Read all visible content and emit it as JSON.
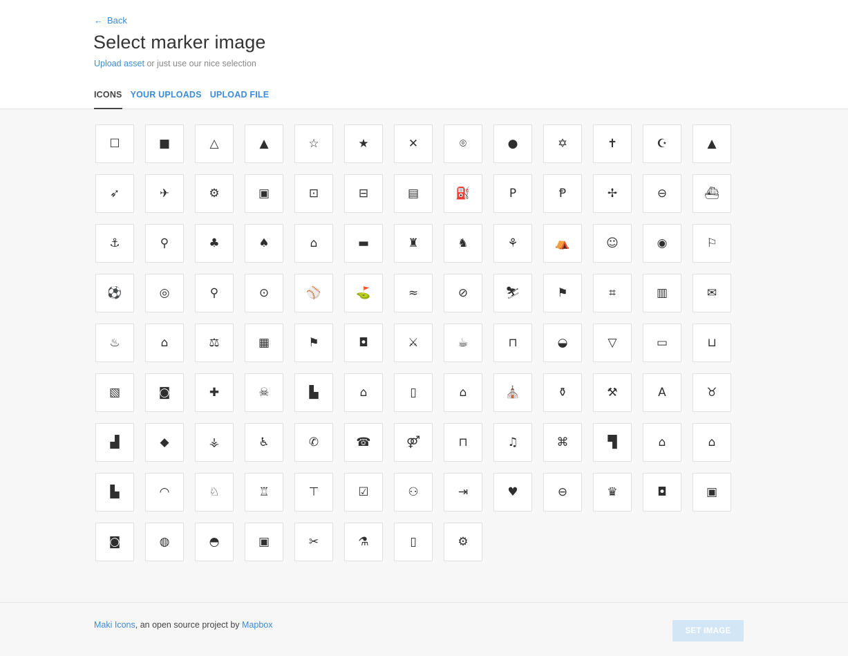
{
  "header": {
    "back_label": "Back",
    "title": "Select marker image",
    "upload_link": "Upload asset",
    "subtitle_rest": " or just use our nice selection"
  },
  "tabs": [
    {
      "label": "ICONS",
      "active": true
    },
    {
      "label": "YOUR UPLOADS",
      "active": false
    },
    {
      "label": "UPLOAD FILE",
      "active": false
    }
  ],
  "icons": [
    {
      "name": "square-stroked",
      "glyph": "☐"
    },
    {
      "name": "square",
      "glyph": "■"
    },
    {
      "name": "triangle-stroked",
      "glyph": "△"
    },
    {
      "name": "triangle",
      "glyph": "▲"
    },
    {
      "name": "star-stroked",
      "glyph": "☆"
    },
    {
      "name": "star",
      "glyph": "★"
    },
    {
      "name": "cross",
      "glyph": "✕"
    },
    {
      "name": "marker-stroked",
      "glyph": "⌾"
    },
    {
      "name": "marker",
      "glyph": "●"
    },
    {
      "name": "religious-jewish",
      "glyph": "✡"
    },
    {
      "name": "religious-christian",
      "glyph": "✝"
    },
    {
      "name": "religious-muslim",
      "glyph": "☪"
    },
    {
      "name": "cemetery",
      "glyph": "▲"
    },
    {
      "name": "rocket",
      "glyph": "➶"
    },
    {
      "name": "airport",
      "glyph": "✈"
    },
    {
      "name": "heliport",
      "glyph": "⚙"
    },
    {
      "name": "rail",
      "glyph": "▣"
    },
    {
      "name": "rail-metro",
      "glyph": "⊡"
    },
    {
      "name": "rail-light",
      "glyph": "⊟"
    },
    {
      "name": "bus",
      "glyph": "▤"
    },
    {
      "name": "fuel",
      "glyph": "⛽"
    },
    {
      "name": "parking",
      "glyph": "P"
    },
    {
      "name": "parking-garage",
      "glyph": "Ᵽ"
    },
    {
      "name": "airfield",
      "glyph": "✢"
    },
    {
      "name": "roadblock",
      "glyph": "⊖"
    },
    {
      "name": "ferry",
      "glyph": "⛴"
    },
    {
      "name": "harbor",
      "glyph": "⚓"
    },
    {
      "name": "bicycle",
      "glyph": "⚲"
    },
    {
      "name": "park",
      "glyph": "♣"
    },
    {
      "name": "park2",
      "glyph": "♠"
    },
    {
      "name": "museum",
      "glyph": "⌂"
    },
    {
      "name": "lodging",
      "glyph": "▬"
    },
    {
      "name": "monument",
      "glyph": "♜"
    },
    {
      "name": "zoo",
      "glyph": "♞"
    },
    {
      "name": "garden",
      "glyph": "⚘"
    },
    {
      "name": "campsite",
      "glyph": "⛺"
    },
    {
      "name": "theatre",
      "glyph": "☺"
    },
    {
      "name": "art-gallery",
      "glyph": "◉"
    },
    {
      "name": "pitch",
      "glyph": "⚐"
    },
    {
      "name": "soccer",
      "glyph": "⚽"
    },
    {
      "name": "america-football",
      "glyph": "◎"
    },
    {
      "name": "tennis",
      "glyph": "⚲"
    },
    {
      "name": "basketball",
      "glyph": "⊙"
    },
    {
      "name": "baseball",
      "glyph": "⚾"
    },
    {
      "name": "golf",
      "glyph": "⛳"
    },
    {
      "name": "swimming",
      "glyph": "≈"
    },
    {
      "name": "cricket",
      "glyph": "⊘"
    },
    {
      "name": "skiing",
      "glyph": "⛷"
    },
    {
      "name": "school",
      "glyph": "⚑"
    },
    {
      "name": "college",
      "glyph": "⌗"
    },
    {
      "name": "library",
      "glyph": "▥"
    },
    {
      "name": "post",
      "glyph": "✉"
    },
    {
      "name": "fire-station",
      "glyph": "♨"
    },
    {
      "name": "town-hall",
      "glyph": "⌂"
    },
    {
      "name": "police",
      "glyph": "⚖"
    },
    {
      "name": "prison",
      "glyph": "▦"
    },
    {
      "name": "embassy",
      "glyph": "⚑"
    },
    {
      "name": "beer",
      "glyph": "◘"
    },
    {
      "name": "restaurant",
      "glyph": "⚔"
    },
    {
      "name": "cafe",
      "glyph": "☕"
    },
    {
      "name": "shop",
      "glyph": "⊓"
    },
    {
      "name": "fast-food",
      "glyph": "◒"
    },
    {
      "name": "bar",
      "glyph": "▽"
    },
    {
      "name": "bank",
      "glyph": "▭"
    },
    {
      "name": "grocery",
      "glyph": "⊔"
    },
    {
      "name": "cinema",
      "glyph": "▧"
    },
    {
      "name": "pharmacy",
      "glyph": "◙"
    },
    {
      "name": "hospital",
      "glyph": "✚"
    },
    {
      "name": "danger",
      "glyph": "☠"
    },
    {
      "name": "industrial",
      "glyph": "▙"
    },
    {
      "name": "warehouse",
      "glyph": "⌂"
    },
    {
      "name": "commercial",
      "glyph": "▯"
    },
    {
      "name": "building",
      "glyph": "⌂"
    },
    {
      "name": "place-of-worship",
      "glyph": "⛪"
    },
    {
      "name": "alcohol-shop",
      "glyph": "⚱"
    },
    {
      "name": "logging",
      "glyph": "⚒"
    },
    {
      "name": "oil-well",
      "glyph": "A"
    },
    {
      "name": "slaughterhouse",
      "glyph": "♉"
    },
    {
      "name": "dam",
      "glyph": "▟"
    },
    {
      "name": "water",
      "glyph": "◆"
    },
    {
      "name": "wetland",
      "glyph": "⚶"
    },
    {
      "name": "disability",
      "glyph": "♿"
    },
    {
      "name": "telephone",
      "glyph": "✆"
    },
    {
      "name": "emergency-telephone",
      "glyph": "☎"
    },
    {
      "name": "toilets",
      "glyph": "⚤"
    },
    {
      "name": "waste-basket",
      "glyph": "⊓"
    },
    {
      "name": "music",
      "glyph": "♫"
    },
    {
      "name": "land-use",
      "glyph": "⌘"
    },
    {
      "name": "city",
      "glyph": "▜"
    },
    {
      "name": "town",
      "glyph": "⌂"
    },
    {
      "name": "village",
      "glyph": "⌂"
    },
    {
      "name": "farm",
      "glyph": "▙"
    },
    {
      "name": "bakery",
      "glyph": "◠"
    },
    {
      "name": "dog-park",
      "glyph": "♘"
    },
    {
      "name": "lighthouse",
      "glyph": "♖"
    },
    {
      "name": "clothing-store",
      "glyph": "⊤"
    },
    {
      "name": "polling-place",
      "glyph": "☑"
    },
    {
      "name": "playground",
      "glyph": "⚇"
    },
    {
      "name": "entrance",
      "glyph": "⇥"
    },
    {
      "name": "heart",
      "glyph": "♥"
    },
    {
      "name": "london-underground",
      "glyph": "⊖"
    },
    {
      "name": "minefield",
      "glyph": "♛"
    },
    {
      "name": "rail-underground",
      "glyph": "◘"
    },
    {
      "name": "rail-above",
      "glyph": "▣"
    },
    {
      "name": "camera",
      "glyph": "◙"
    },
    {
      "name": "laundry",
      "glyph": "◍"
    },
    {
      "name": "car",
      "glyph": "◓"
    },
    {
      "name": "suitcase",
      "glyph": "▣"
    },
    {
      "name": "hairdresser",
      "glyph": "✂"
    },
    {
      "name": "chemist",
      "glyph": "⚗"
    },
    {
      "name": "mobilephone",
      "glyph": "▯"
    },
    {
      "name": "scooter",
      "glyph": "⚙"
    }
  ],
  "footer": {
    "maki_link": "Maki Icons",
    "credit_middle": ", an open source project by ",
    "mapbox_link": "Mapbox",
    "set_button": "SET IMAGE"
  },
  "colors": {
    "accent": "#3a8bd9",
    "button_disabled": "#d3e6f6",
    "icon": "#2f2f2f"
  }
}
